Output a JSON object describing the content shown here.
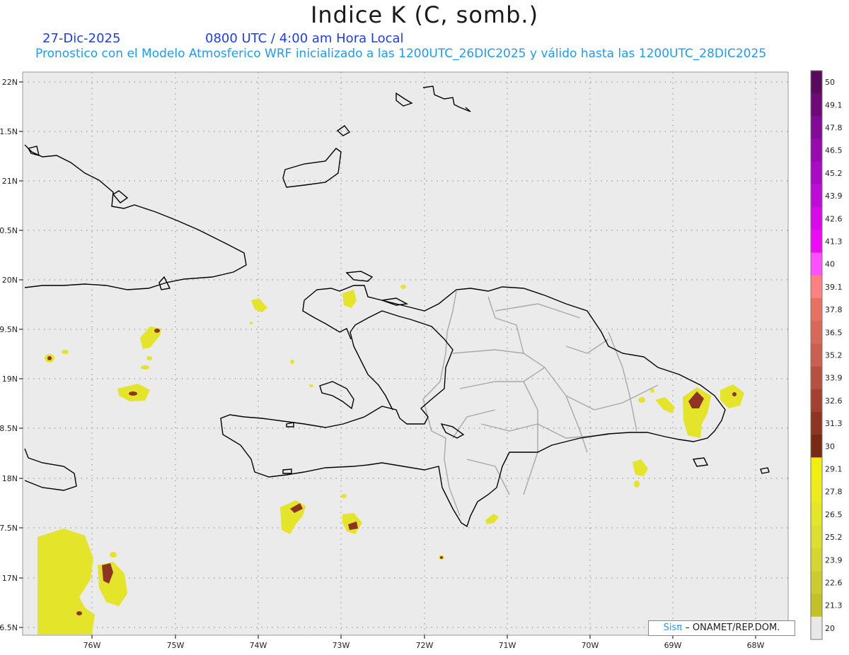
{
  "header": {
    "title": "Indice K (C, somb.)",
    "date": "27-Dic-2025",
    "time": "0800 UTC / 4:00 am Hora Local",
    "subtitle": "Pronostico con el Modelo Atmosferico WRF inicializado a las 1200UTC_26DIC2025 y válido hasta las  1200UTC_28DIC2025"
  },
  "map": {
    "lat_labels": [
      "22N",
      "1.5N",
      "21N",
      "0.5N",
      "20N",
      "9.5N",
      "19N",
      "8.5N",
      "18N",
      "7.5N",
      "17N",
      "6.5N"
    ],
    "lon_labels": [
      "76W",
      "75W",
      "74W",
      "73W",
      "72W",
      "71W",
      "70W",
      "69W",
      "68W"
    ],
    "background": "#ebebeb",
    "coast_color": "#000000",
    "border_color": "#a8a8a8"
  },
  "legend": {
    "labels": [
      "50",
      "49.1",
      "47.8",
      "46.5",
      "45.2",
      "43.9",
      "42.6",
      "41.3",
      "40",
      "39.1",
      "37.8",
      "36.5",
      "35.2",
      "33.9",
      "32.6",
      "31.3",
      "30",
      "29.1",
      "27.8",
      "26.5",
      "25.2",
      "23.9",
      "22.6",
      "21.3",
      "20"
    ],
    "colors": [
      "#5a0a5e",
      "#6e0a78",
      "#820a96",
      "#960aae",
      "#aa0ac6",
      "#c00ad8",
      "#d80ae8",
      "#ee0af6",
      "#ff50ff",
      "#ff8080",
      "#e87060",
      "#da6858",
      "#cc6050",
      "#b85040",
      "#a44030",
      "#8e3422",
      "#782a14",
      "#f0f010",
      "#ecec1a",
      "#e6e628",
      "#dede30",
      "#d6d630",
      "#cccc30",
      "#c2c228",
      "#e8e8e8"
    ]
  },
  "footer": {
    "brand": "Sisπ",
    "org": "– ONAMET/REP.DOM."
  }
}
